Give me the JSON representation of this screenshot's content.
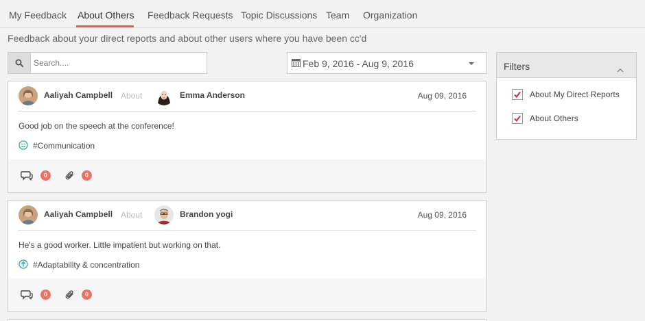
{
  "tabs": [
    {
      "label": "My Feedback",
      "active": false
    },
    {
      "label": "About Others",
      "active": true
    },
    {
      "label": "Feedback Requests",
      "active": false
    },
    {
      "label": "Topic Discussions",
      "active": false
    },
    {
      "label": "Team",
      "active": false
    },
    {
      "label": "Organization",
      "active": false
    }
  ],
  "colors": {
    "accent": "#e8604c",
    "badge": "#ef7166",
    "check": "#d9332a",
    "communication_icon": "#2fb38a",
    "adaptability_icon": "#3a9ec6"
  },
  "subtitle": "Feedback about your direct reports and about other users where you have been cc'd",
  "search": {
    "placeholder": "Search....",
    "value": "",
    "icon": "search-icon"
  },
  "date_range": {
    "label": "Feb 9, 2016 - Aug 9, 2016",
    "icon": "calendar-icon"
  },
  "feedback": [
    {
      "author": "Aaliyah Campbell",
      "about_label": "About",
      "subject": "Emma Anderson",
      "date": "Aug 09, 2016",
      "message": "Good job on the speech at the conference!",
      "tag": "#Communication",
      "tag_icon": "smiley-icon",
      "comments": "0",
      "attachments": "0"
    },
    {
      "author": "Aaliyah Campbell",
      "about_label": "About",
      "subject": "Brandon yogi",
      "date": "Aug 09, 2016",
      "message": "He's a good worker. Little impatient but working on that.",
      "tag": "#Adaptability & concentration",
      "tag_icon": "arrow-up-circle-icon",
      "comments": "0",
      "attachments": "0"
    }
  ],
  "filters": {
    "title": "Filters",
    "options": [
      {
        "label": "About My Direct Reports",
        "checked": true
      },
      {
        "label": "About Others",
        "checked": true
      }
    ]
  }
}
